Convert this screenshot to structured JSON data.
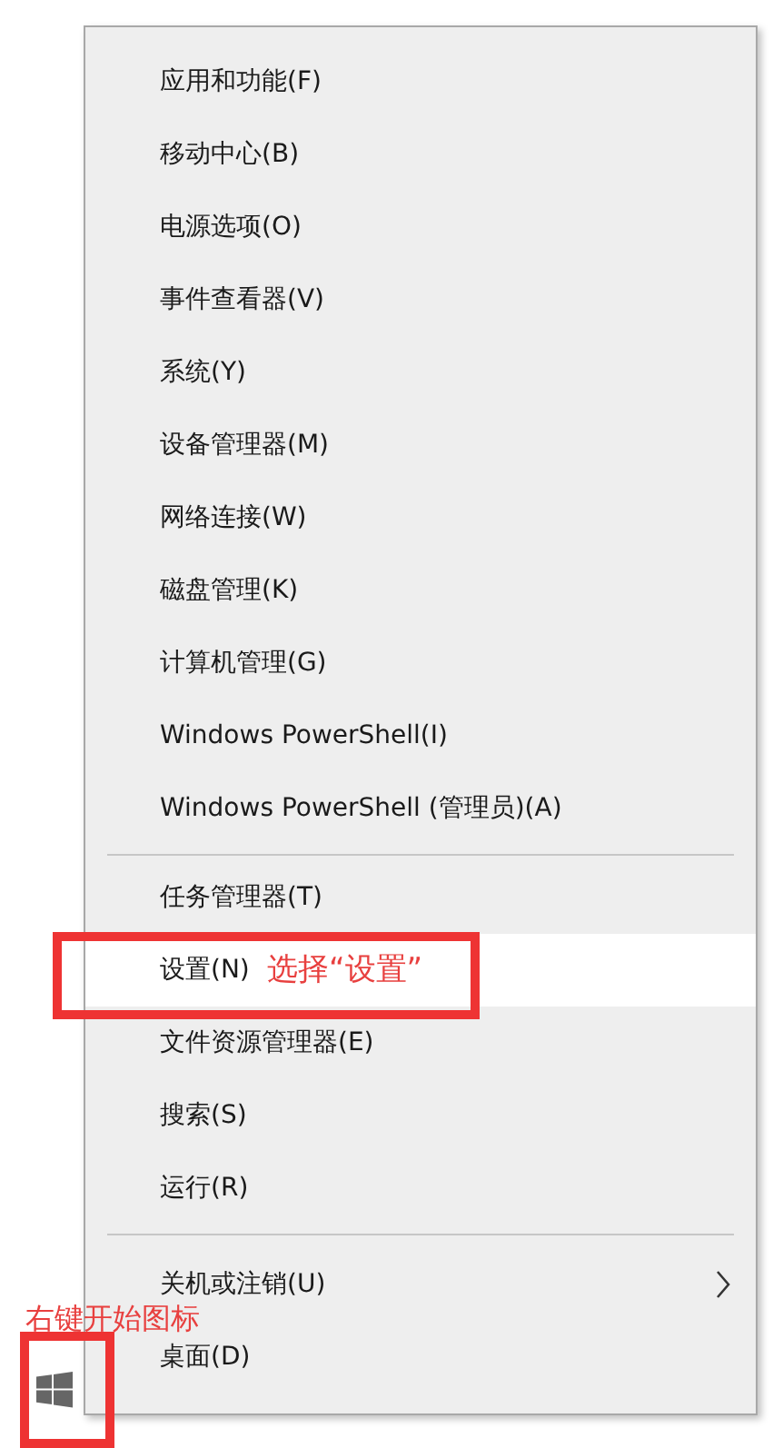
{
  "menu": {
    "groups": [
      {
        "items": [
          {
            "label": "应用和功能(F)",
            "selected": false,
            "submenu": false
          },
          {
            "label": "移动中心(B)",
            "selected": false,
            "submenu": false
          },
          {
            "label": "电源选项(O)",
            "selected": false,
            "submenu": false
          },
          {
            "label": "事件查看器(V)",
            "selected": false,
            "submenu": false
          },
          {
            "label": "系统(Y)",
            "selected": false,
            "submenu": false
          },
          {
            "label": "设备管理器(M)",
            "selected": false,
            "submenu": false
          },
          {
            "label": "网络连接(W)",
            "selected": false,
            "submenu": false
          },
          {
            "label": "磁盘管理(K)",
            "selected": false,
            "submenu": false
          },
          {
            "label": "计算机管理(G)",
            "selected": false,
            "submenu": false
          },
          {
            "label": "Windows PowerShell(I)",
            "selected": false,
            "submenu": false
          },
          {
            "label": "Windows PowerShell (管理员)(A)",
            "selected": false,
            "submenu": false
          }
        ]
      },
      {
        "items": [
          {
            "label": "任务管理器(T)",
            "selected": false,
            "submenu": false
          },
          {
            "label": "设置(N)",
            "selected": true,
            "submenu": false
          },
          {
            "label": "文件资源管理器(E)",
            "selected": false,
            "submenu": false
          },
          {
            "label": "搜索(S)",
            "selected": false,
            "submenu": false
          },
          {
            "label": "运行(R)",
            "selected": false,
            "submenu": false
          }
        ]
      },
      {
        "items": [
          {
            "label": "关机或注销(U)",
            "selected": false,
            "submenu": true
          },
          {
            "label": "桌面(D)",
            "selected": false,
            "submenu": false
          }
        ]
      }
    ]
  },
  "annotations": {
    "menu_note": "选择“设置”",
    "start_note": "右键开始图标"
  }
}
